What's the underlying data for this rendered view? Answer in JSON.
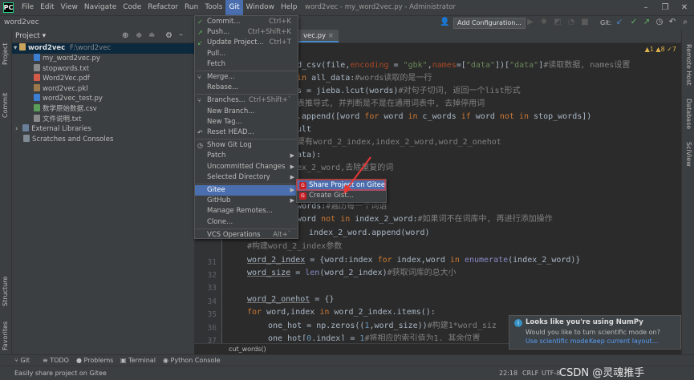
{
  "menubar": {
    "items": [
      "File",
      "Edit",
      "View",
      "Navigate",
      "Code",
      "Refactor",
      "Run",
      "Tools",
      "Git",
      "Window",
      "Help"
    ],
    "window_title": "word2vec - my_word2vec.py - Administrator"
  },
  "navbar": {
    "breadcrumb": "word2vec",
    "add_configuration": "Add Configuration...",
    "git_label": "Git:"
  },
  "project_panel": {
    "title": "Project",
    "root_name": "word2vec",
    "root_path": "F:\\word2vec",
    "files": [
      {
        "name": "my_word2vec.py",
        "color": "#3c7ed1"
      },
      {
        "name": "stopwords.txt",
        "color": "#8a8a8a"
      },
      {
        "name": "Word2Vec.pdf",
        "color": "#d35b4a"
      },
      {
        "name": "word2vec.pkl",
        "color": "#9c7a4b"
      },
      {
        "name": "word2vec_test.py",
        "color": "#3c7ed1"
      },
      {
        "name": "数学原始数据.csv",
        "color": "#5a9e5a"
      },
      {
        "name": "文件说明.txt",
        "color": "#8a8a8a"
      }
    ],
    "external_libraries": "External Libraries",
    "scratches": "Scratches and Consoles"
  },
  "left_strip": [
    "Project",
    "Commit",
    "Structure",
    "Favorites"
  ],
  "right_strip": [
    "Remote Host",
    "Database",
    "SciView"
  ],
  "editor": {
    "active_tab": "vec.py",
    "inspections": "▲1  ▲8  ✓7",
    "line_numbers": [
      "31",
      "32",
      "33",
      "34",
      "35",
      "36",
      "37"
    ],
    "bottom_crumb": "cut_words()"
  },
  "git_menu": {
    "items": [
      {
        "label": "Commit...",
        "shortcut": "Ctrl+K",
        "check": "✓"
      },
      {
        "label": "Push...",
        "shortcut": "Ctrl+Shift+K",
        "check": "↗"
      },
      {
        "label": "Update Project...",
        "shortcut": "Ctrl+T",
        "check": "↙"
      },
      {
        "label": "Pull...",
        "shortcut": "",
        "check": ""
      },
      {
        "label": "Fetch",
        "shortcut": "",
        "check": ""
      },
      {
        "label": "Merge...",
        "shortcut": "",
        "check": "⑂"
      },
      {
        "label": "Rebase...",
        "shortcut": "",
        "check": ""
      },
      {
        "label": "Branches...",
        "shortcut": "Ctrl+Shift+`",
        "check": "⑂"
      },
      {
        "label": "New Branch...",
        "shortcut": "",
        "check": ""
      },
      {
        "label": "New Tag...",
        "shortcut": "",
        "check": ""
      },
      {
        "label": "Reset HEAD...",
        "shortcut": "",
        "check": "↶"
      },
      {
        "label": "Show Git Log",
        "shortcut": "",
        "check": "◷"
      },
      {
        "label": "Patch",
        "shortcut": "",
        "check": ""
      },
      {
        "label": "Uncommitted Changes",
        "shortcut": "",
        "check": ""
      },
      {
        "label": "Selected Directory",
        "shortcut": "",
        "check": ""
      },
      {
        "label": "Gitee",
        "shortcut": "",
        "check": ""
      },
      {
        "label": "GitHub",
        "shortcut": "",
        "check": ""
      },
      {
        "label": "Manage Remotes...",
        "shortcut": "",
        "check": ""
      },
      {
        "label": "Clone...",
        "shortcut": "",
        "check": ""
      },
      {
        "label": "VCS Operations",
        "shortcut": "Alt+`",
        "check": ""
      }
    ]
  },
  "gitee_submenu": {
    "items": [
      "Share Project on Gitee",
      "Create Gist..."
    ]
  },
  "notification": {
    "title": "Looks like you're using NumPy",
    "body": "Would you like to turn scientific mode on?",
    "action1": "Use scientific mode",
    "action2": "Keep current layout..."
  },
  "bottom_tools": [
    "Git",
    "TODO",
    "Problems",
    "Terminal",
    "Python Console"
  ],
  "statusbar": {
    "message": "Easily share project on Gitee",
    "position": "22:18",
    "line_sep": "CRLF",
    "encoding": "UTF-8",
    "watermark": "CSDN @灵魂推手"
  },
  "colors": {
    "accent": "#4b6eaf",
    "gitee_red": "#c71d23",
    "arrow_red": "#e53935"
  }
}
